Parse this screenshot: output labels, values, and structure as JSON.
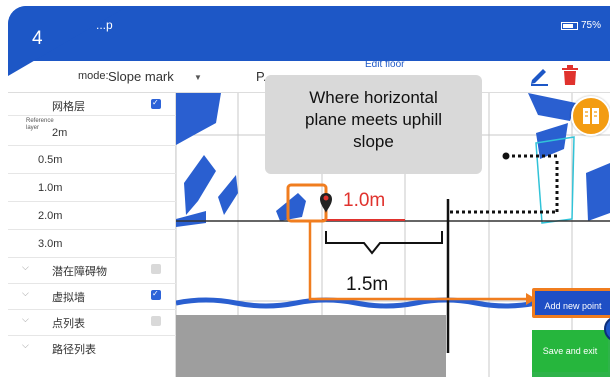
{
  "step_number": "4",
  "app_title": "...p",
  "battery_text": "75%",
  "mode": {
    "label": "mode:",
    "value": "Slope mark",
    "second_value": "P...",
    "edit_floor": "Edit floor"
  },
  "sidebar": {
    "items": [
      {
        "label": "网格层",
        "checked": true
      },
      {
        "label": "2m",
        "sub": "Reference layer"
      },
      {
        "label": "0.5m"
      },
      {
        "label": "1.0m"
      },
      {
        "label": "2.0m"
      },
      {
        "label": "3.0m"
      },
      {
        "label": "潜在障碍物",
        "checked": false,
        "chevron": "⌵"
      },
      {
        "label": "虚拟墙",
        "checked": true,
        "chevron": "⌵"
      },
      {
        "label": "点列表",
        "checked": false,
        "chevron": "⌵"
      },
      {
        "label": "路径列表",
        "chevron": "⌵"
      }
    ]
  },
  "map": {
    "callout_text": "Where horizontal\nplane meets uphill\nslope",
    "measure_label": "1.0m",
    "span_label": "1.5m",
    "add_point_button": "Add new point",
    "save_exit_button": "Save and exit"
  },
  "colors": {
    "brand_blue": "#1d57c6",
    "highlight_orange": "#f07d1f",
    "measure_red": "#e0322d",
    "save_green": "#26b63d",
    "map_wall_blue": "#2a5fd0"
  }
}
